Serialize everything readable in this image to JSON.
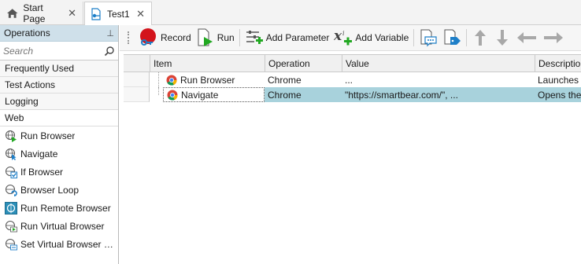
{
  "tabs": [
    {
      "label": "Start Page",
      "icon": "home-icon"
    },
    {
      "label": "Test1",
      "icon": "test-icon"
    }
  ],
  "operations_panel": {
    "title": "Operations",
    "search_placeholder": "Search",
    "categories": [
      "Frequently Used",
      "Test Actions",
      "Logging",
      "Web"
    ],
    "web_items": [
      {
        "label": "Run Browser",
        "icon": "run-browser-icon"
      },
      {
        "label": "Navigate",
        "icon": "navigate-icon"
      },
      {
        "label": "If Browser",
        "icon": "if-browser-icon"
      },
      {
        "label": "Browser Loop",
        "icon": "browser-loop-icon"
      },
      {
        "label": "Run Remote Browser",
        "icon": "run-remote-browser-icon"
      },
      {
        "label": "Run Virtual Browser",
        "icon": "run-virtual-browser-icon"
      },
      {
        "label": "Set Virtual Browser O...",
        "icon": "set-virtual-browser-icon"
      }
    ]
  },
  "toolbar": {
    "record_label": "Record",
    "run_label": "Run",
    "add_parameter_label": "Add Parameter",
    "add_variable_label": "Add Variable"
  },
  "grid": {
    "columns": [
      "Item",
      "Operation",
      "Value",
      "Description"
    ],
    "rows": [
      {
        "item": "Run Browser",
        "operation": "Chrome",
        "value": "...",
        "description": "Launches th"
      },
      {
        "item": "Navigate",
        "operation": "Chrome",
        "value": "\"https://smartbear.com/\", ...",
        "description": "Opens the s"
      }
    ]
  },
  "colors": {
    "selection": "#a8d2dc",
    "panel_header": "#cfe0ea",
    "record_red": "#d3141c",
    "run_green": "#22a822",
    "accent_blue": "#1e7fc8"
  }
}
